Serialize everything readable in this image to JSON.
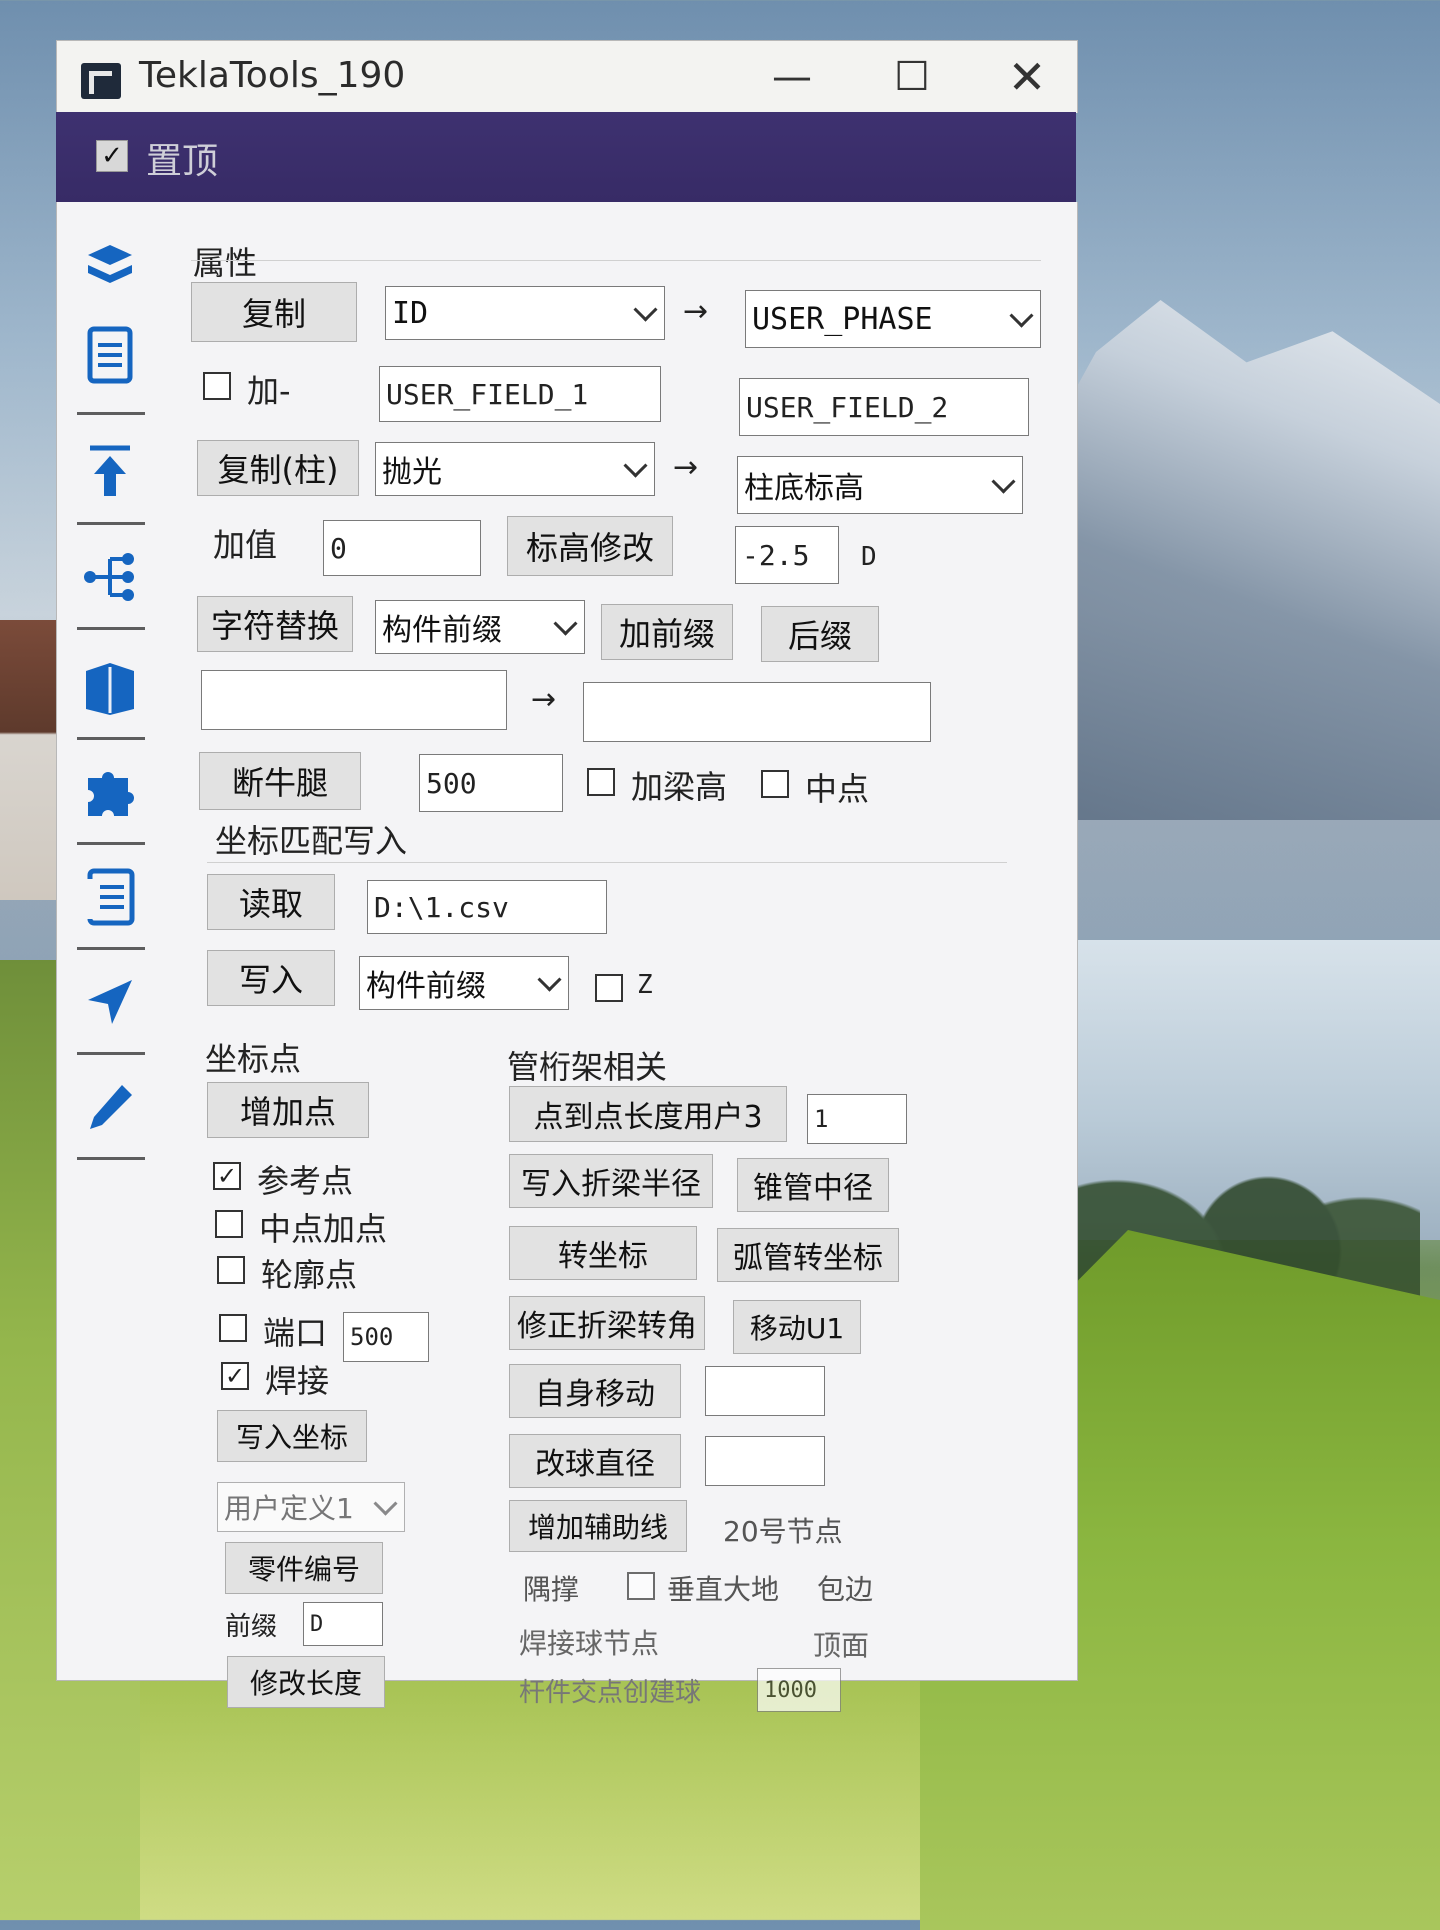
{
  "window": {
    "title": "TeklaTools_190",
    "controls": {
      "minimize": "—",
      "maximize": "☐",
      "close": "✕"
    }
  },
  "menubar": {
    "topmost_label": "置顶",
    "topmost_checked": true
  },
  "sidebar": {
    "icons": [
      "layers-icon",
      "document-icon",
      "upload-arrow-icon",
      "share-tree-icon",
      "book-icon",
      "puzzle-icon",
      "list-document-icon",
      "navigate-arrow-icon",
      "pen-icon"
    ]
  },
  "attributes": {
    "section_label": "属性",
    "copy_button": "复制",
    "copy_source": "ID",
    "copy_target": "USER_PHASE",
    "add_label": "加-",
    "add_checked": false,
    "field1": "USER_FIELD_1",
    "field2": "USER_FIELD_2",
    "copy_column_button": "复制(柱)",
    "column_source": "抛光",
    "column_target": "柱底标高",
    "add_value_label": "加值",
    "add_value": "0",
    "elevation_button": "标高修改",
    "elevation_value": "-2.5",
    "elevation_unit": "D",
    "replace_button": "字符替换",
    "replace_combo": "构件前缀",
    "add_prefix_button": "加前缀",
    "suffix_button": "后缀",
    "replace_from": "",
    "replace_to": "",
    "corbel_button": "断牛腿",
    "corbel_value": "500",
    "add_beam_height_label": "加梁高",
    "midpoint_label": "中点"
  },
  "coord_match": {
    "section_label": "坐标匹配写入",
    "read_button": "读取",
    "file_path": "D:\\1.csv",
    "write_button": "写入",
    "write_combo": "构件前缀",
    "z_label": "Z"
  },
  "coord_points": {
    "section_label": "坐标点",
    "add_point_button": "增加点",
    "ref_point_label": "参考点",
    "ref_point_checked": true,
    "mid_add_label": "中点加点",
    "outline_label": "轮廓点",
    "port_label": "端口",
    "port_value": "500",
    "weld_label": "焊接",
    "weld_checked": true,
    "write_coord_button": "写入坐标",
    "user_def_combo": "用户定义1",
    "part_number_button": "零件编号",
    "prefix_label": "前缀",
    "prefix_value": "D",
    "modify_length_button": "修改长度"
  },
  "pipe_truss": {
    "section_label": "管桁架相关",
    "p2p_length_button": "点到点长度用户3",
    "p2p_value": "1",
    "write_fold_radius_button": "写入折梁半径",
    "cone_mid_diameter_button": "锥管中径",
    "convert_coord_button": "转坐标",
    "arc_convert_coord_button": "弧管转坐标",
    "fix_fold_angle_button": "修正折梁转角",
    "move_u1_button": "移动U1",
    "self_move_button": "自身移动",
    "self_move_value": "",
    "ball_diameter_button": "改球直径",
    "ball_diameter_value": "",
    "add_aux_line_button": "增加辅助线",
    "node20_label": "20号节点",
    "brace_label": "隅撑",
    "vertical_ground_label": "垂直大地",
    "wrap_edge_label": "包边",
    "weld_ball_node_label": "焊接球节点",
    "top_face_label": "顶面",
    "member_intersect_ball_label": "杆件交点创建球",
    "member_intersect_value": "1000"
  }
}
